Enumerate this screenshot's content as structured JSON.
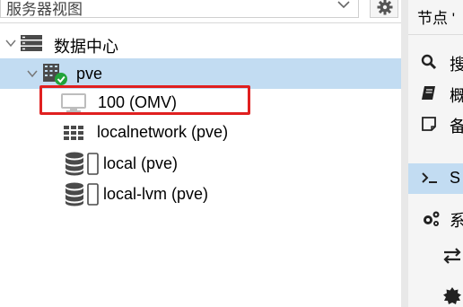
{
  "tree_panel": {
    "view_selector_label": "服务器视图",
    "items": [
      {
        "label": "数据中心",
        "icon": "datacenter-icon"
      },
      {
        "label": "pve",
        "icon": "node-online-icon",
        "selected": true
      },
      {
        "label": "100 (OMV)",
        "icon": "vm-stopped-icon",
        "highlighted": true
      },
      {
        "label": "localnetwork (pve)",
        "icon": "sdn-network-icon"
      },
      {
        "label": "local (pve)",
        "icon": "storage-icon"
      },
      {
        "label": "local-lvm (pve)",
        "icon": "storage-icon"
      }
    ]
  },
  "node_panel": {
    "title": "节点 '",
    "nav_items": [
      {
        "label": "搜",
        "icon": "search-icon"
      },
      {
        "label": "概",
        "icon": "book-icon"
      },
      {
        "label": "备",
        "icon": "notes-icon"
      },
      {
        "label": "S",
        "icon": "shell-icon",
        "active": true
      },
      {
        "label": "系",
        "icon": "cogs-icon"
      },
      {
        "label": "",
        "icon": "exchange-icon"
      },
      {
        "label": "",
        "icon": "certificate-icon"
      }
    ]
  },
  "colors": {
    "selected_row": "#c2dcf2",
    "highlight_border": "#e02020",
    "status_green": "#21a33a"
  }
}
